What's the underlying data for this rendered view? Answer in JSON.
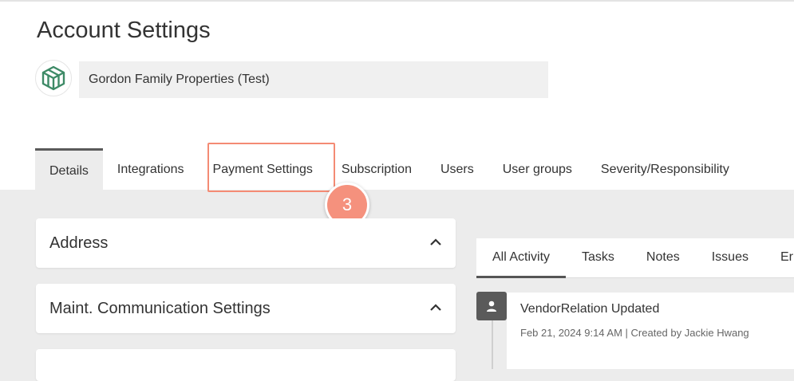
{
  "page": {
    "title": "Account Settings"
  },
  "account": {
    "name": "Gordon Family Properties (Test)"
  },
  "tabs": [
    {
      "label": "Details"
    },
    {
      "label": "Integrations"
    },
    {
      "label": "Payment Settings"
    },
    {
      "label": "Subscription"
    },
    {
      "label": "Users"
    },
    {
      "label": "User groups"
    },
    {
      "label": "Severity/Responsibility"
    }
  ],
  "step_badge": {
    "label": "3"
  },
  "panels": [
    {
      "title": "Address"
    },
    {
      "title": "Maint. Communication Settings"
    }
  ],
  "activity": {
    "tabs": [
      {
        "label": "All Activity"
      },
      {
        "label": "Tasks"
      },
      {
        "label": "Notes"
      },
      {
        "label": "Issues"
      },
      {
        "label": "Er"
      }
    ],
    "events": [
      {
        "title": "VendorRelation Updated",
        "meta": "Feb 21, 2024 9:14 AM | Created by Jackie Hwang"
      }
    ]
  },
  "colors": {
    "highlight": "#f48b74",
    "step_badge": "#f5917d",
    "logo": "#3d8a66"
  }
}
